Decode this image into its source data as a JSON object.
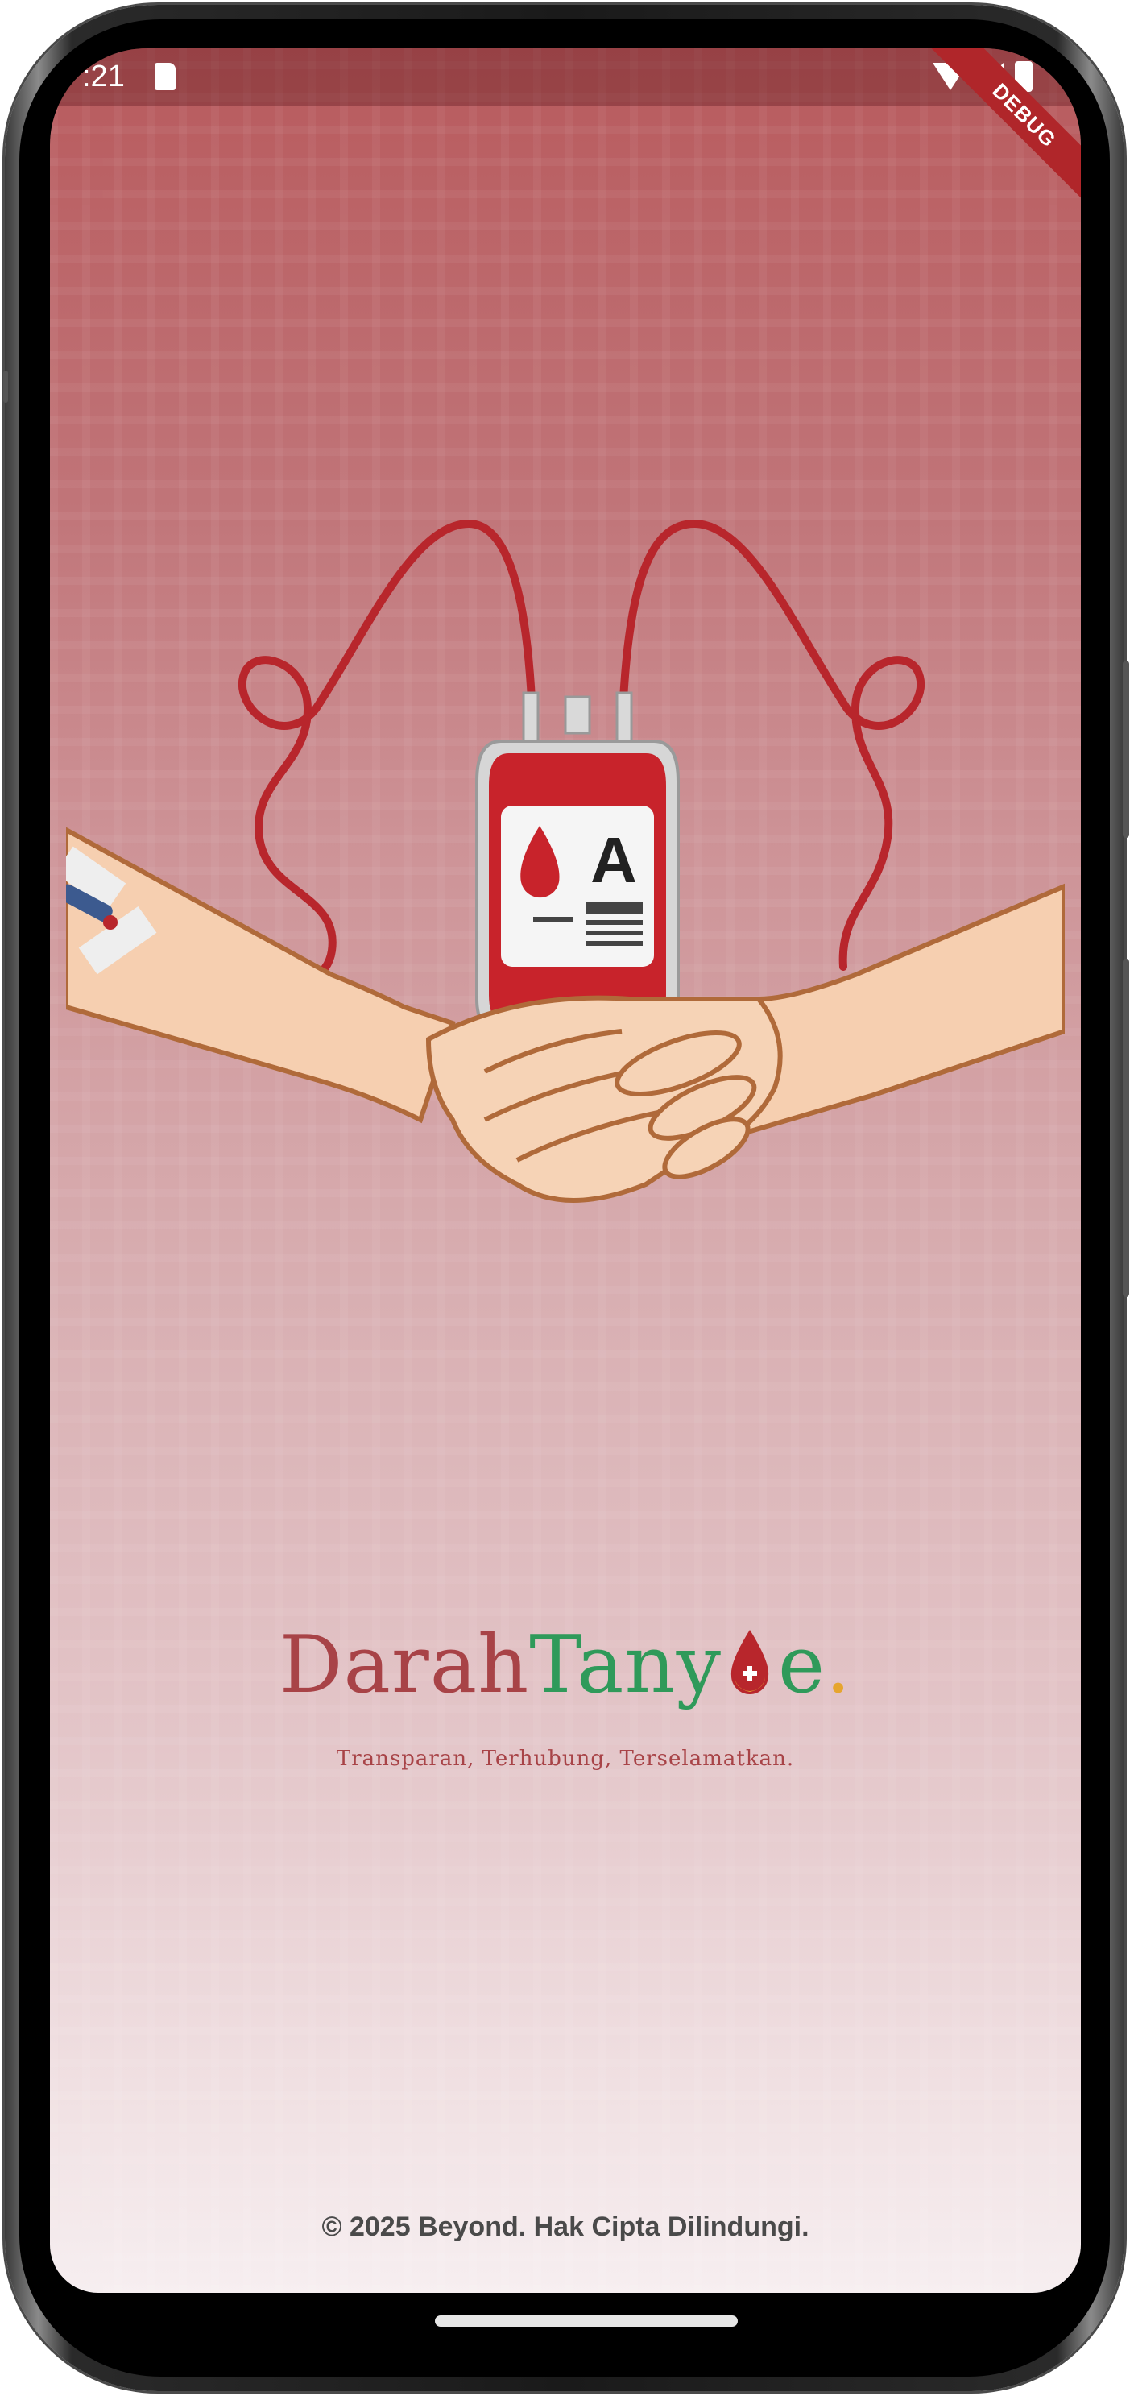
{
  "status_bar": {
    "time": ":21",
    "icons": [
      "sd-card-icon",
      "wifi-icon",
      "signal-icon",
      "battery-icon"
    ]
  },
  "debug_banner": "DEBUG",
  "illustration": {
    "blood_type": "A",
    "icons": [
      "blood-bag-icon",
      "blood-drop-icon",
      "handshake-icon",
      "iv-needle-icon"
    ]
  },
  "brand": {
    "part1": "Darah",
    "part2": "Tany",
    "part3": "e",
    "part4": ".",
    "tagline": "Transparan, Terhubung, Terselamatkan."
  },
  "footer": {
    "copyright": "© 2025 Beyond. Hak Cipta Dilindungi."
  },
  "colors": {
    "brand_red": "#a84347",
    "brand_green": "#2f9a5a",
    "brand_gold": "#e6a52e",
    "bg_top": "#b85a5d",
    "bg_bottom": "#f6eef0"
  }
}
